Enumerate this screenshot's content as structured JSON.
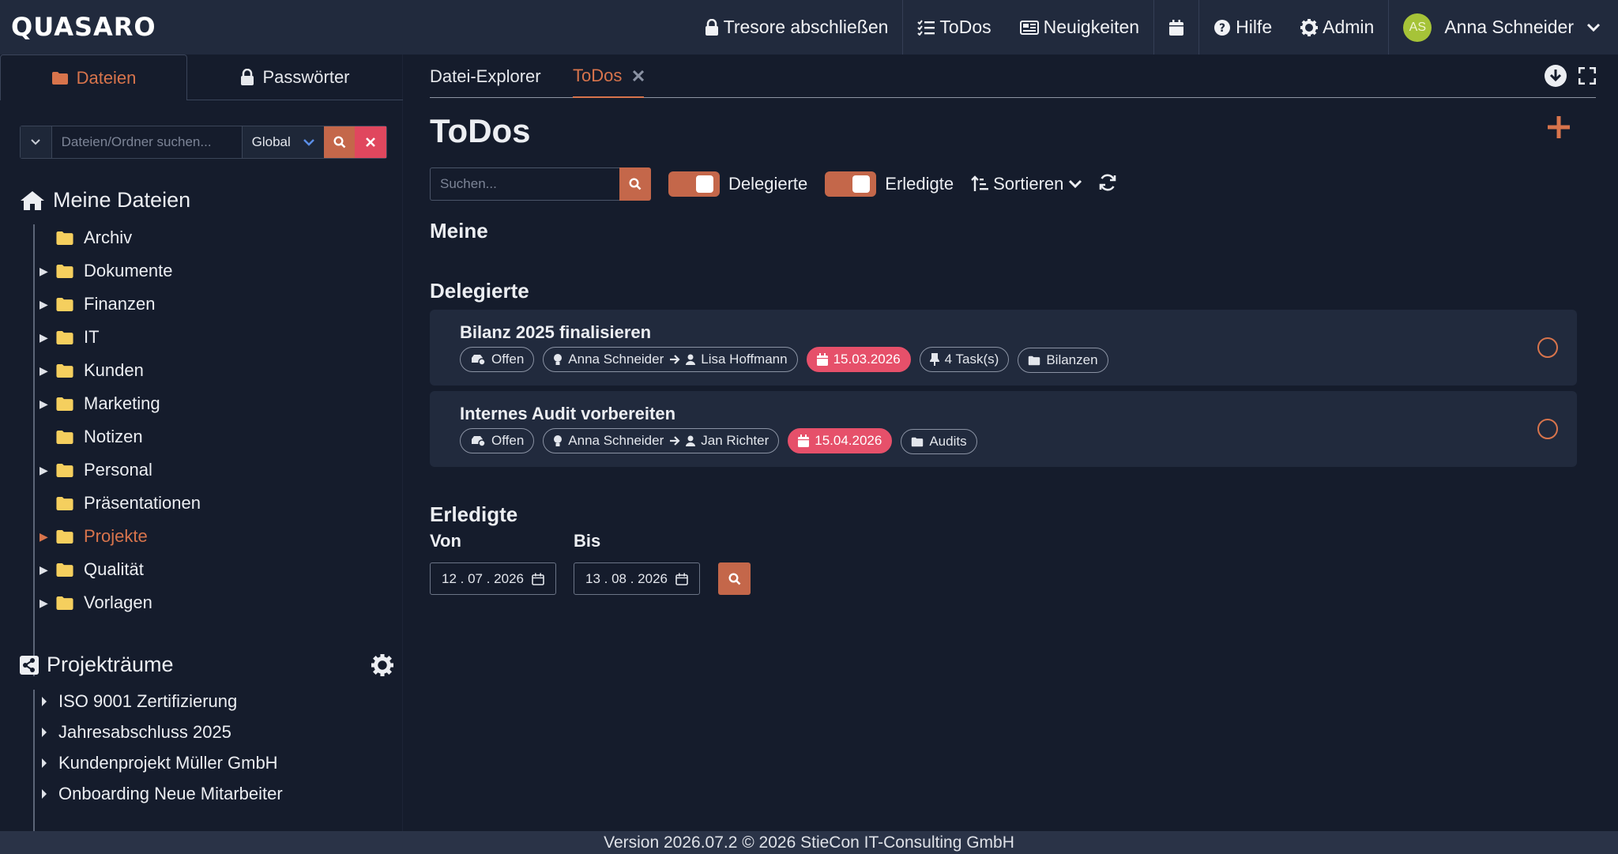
{
  "app": {
    "logo": "QUASARO"
  },
  "topnav": {
    "lock_vaults": "Tresore abschließen",
    "todos": "ToDos",
    "news": "Neuigkeiten",
    "help": "Hilfe",
    "admin": "Admin",
    "user_initials": "AS",
    "user_name": "Anna Schneider"
  },
  "sidebar": {
    "tabs": {
      "files": "Dateien",
      "passwords": "Passwörter"
    },
    "search": {
      "placeholder": "Dateien/Ordner suchen...",
      "scope": "Global"
    },
    "my_files_title": "Meine Dateien",
    "folders": [
      {
        "label": "Archiv",
        "expandable": false
      },
      {
        "label": "Dokumente",
        "expandable": true
      },
      {
        "label": "Finanzen",
        "expandable": true
      },
      {
        "label": "IT",
        "expandable": true
      },
      {
        "label": "Kunden",
        "expandable": true
      },
      {
        "label": "Marketing",
        "expandable": true
      },
      {
        "label": "Notizen",
        "expandable": false
      },
      {
        "label": "Personal",
        "expandable": true
      },
      {
        "label": "Präsentationen",
        "expandable": false
      },
      {
        "label": "Projekte",
        "expandable": true,
        "active": true
      },
      {
        "label": "Qualität",
        "expandable": true
      },
      {
        "label": "Vorlagen",
        "expandable": true
      }
    ],
    "rooms_title": "Projekträume",
    "rooms": [
      {
        "label": "ISO 9001 Zertifizierung"
      },
      {
        "label": "Jahresabschluss 2025"
      },
      {
        "label": "Kundenprojekt Müller GmbH"
      },
      {
        "label": "Onboarding Neue Mitarbeiter"
      }
    ]
  },
  "main": {
    "tabs": {
      "explorer": "Datei-Explorer",
      "todos": "ToDos"
    },
    "title": "ToDos",
    "search_placeholder": "Suchen...",
    "toggle_delegated": "Delegierte",
    "toggle_done": "Erledigte",
    "sort": "Sortieren",
    "groups": {
      "mine": "Meine",
      "delegated": "Delegierte",
      "done": "Erledigte"
    },
    "todos": [
      {
        "title": "Bilanz 2025 finalisieren",
        "status": "Offen",
        "from": "Anna Schneider",
        "to": "Lisa Hoffmann",
        "due": "15.03.2026",
        "tasks": "4 Task(s)",
        "folder": "Bilanzen"
      },
      {
        "title": "Internes Audit vorbereiten",
        "status": "Offen",
        "from": "Anna Schneider",
        "to": "Jan Richter",
        "due": "15.04.2026",
        "folder": "Audits"
      }
    ],
    "range": {
      "from_label": "Von",
      "to_label": "Bis",
      "from": "12 . 07 . 2026",
      "to": "13 . 08 . 2026"
    }
  },
  "footer": {
    "text": "Version 2026.07.2 © 2026 StieCon IT-Consulting GmbH"
  },
  "colors": {
    "accent": "#d8744c",
    "danger": "#e6506a",
    "folder": "#f5cf5e"
  }
}
